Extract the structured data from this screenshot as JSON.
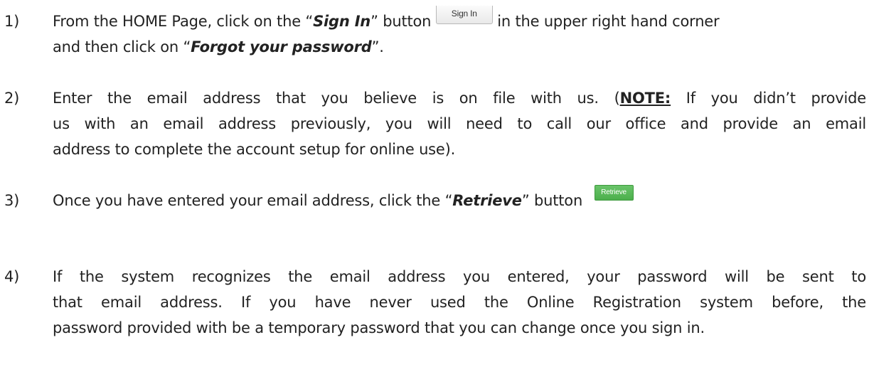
{
  "steps": [
    {
      "number": "1)",
      "p1": "From the HOME Page, click on the “",
      "em1": "Sign In",
      "p2": "” button",
      "button_label": "Sign In",
      "p3": "in the upper right hand corner",
      "l2_a": "and then click on “",
      "em2": "Forgot your password",
      "l2_b": "”."
    },
    {
      "number": "2)",
      "l1_a": "Enter the email address that you believe is on file with us. (",
      "note": "NOTE:",
      "l1_b": " If you didn’t provide",
      "l2": "us with an email address previously, you will need to call our office and provide an email",
      "l3": "address to complete the account setup for online use)."
    },
    {
      "number": "3)",
      "p1": "Once you have entered your email address, click the “",
      "em": "Retrieve",
      "p2": "” button",
      "button_label": "Retrieve"
    },
    {
      "number": "4)",
      "l1": "If the system recognizes the email address you entered, your password will be sent to",
      "l2": "that email address.  If you have never used the Online Registration system before, the",
      "l3": "password provided with be a temporary password that you can change once you sign in."
    }
  ]
}
